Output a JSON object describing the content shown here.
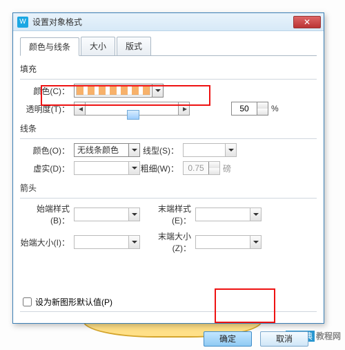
{
  "app_icon": "W",
  "title": "设置对象格式",
  "tabs": {
    "t1": "颜色与线条",
    "t2": "大小",
    "t3": "版式"
  },
  "fill": {
    "group": "填充",
    "color_label": "颜色(C)：",
    "trans_label": "透明度(T)：",
    "trans_value": "50",
    "trans_unit": "%"
  },
  "line": {
    "group": "线条",
    "color_label": "颜色(O)：",
    "color_value": "无线条颜色",
    "style_label": "线型(S)：",
    "dash_label": "虚实(D)：",
    "weight_label": "粗细(W)：",
    "weight_value": "0.75",
    "weight_unit": "磅"
  },
  "arrow": {
    "group": "箭头",
    "begin_style": "始端样式(B)：",
    "end_style": "末端样式(E)：",
    "begin_size": "始端大小(I)：",
    "end_size": "末端大小(Z)："
  },
  "default_check": "设为新图形默认值(P)",
  "btn_ok": "确定",
  "btn_cancel": "取消",
  "watermark": {
    "site1": "查字典",
    "site2": "教程网"
  }
}
